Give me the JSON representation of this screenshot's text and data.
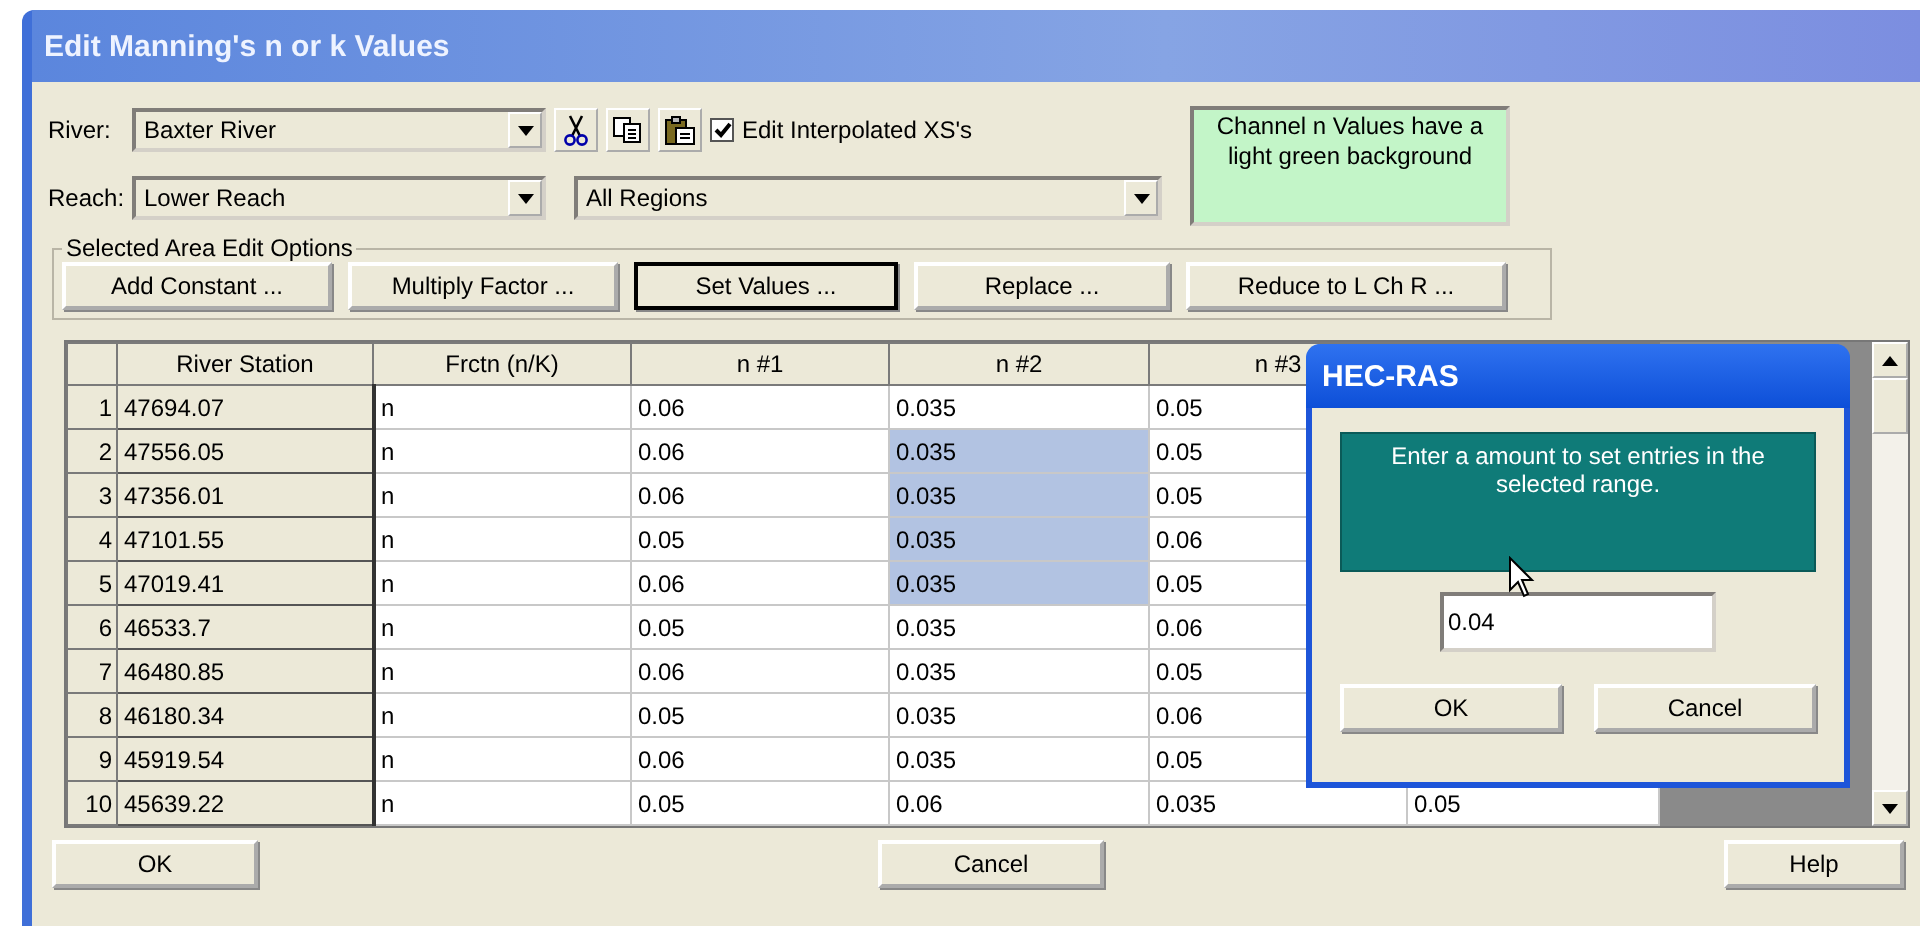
{
  "window": {
    "title": "Edit Manning's n or k Values"
  },
  "river": {
    "label": "River:",
    "value": "Baxter River"
  },
  "reach": {
    "label": "Reach:",
    "value": "Lower Reach"
  },
  "regions": {
    "value": "All Regions"
  },
  "edit_interpolated": {
    "label": "Edit Interpolated XS's",
    "checked": true
  },
  "note": "Channel n Values have a light green background",
  "edit_options": {
    "title": "Selected Area Edit Options",
    "buttons": [
      {
        "label": "Add Constant ...",
        "focused": false
      },
      {
        "label": "Multiply Factor ...",
        "focused": false
      },
      {
        "label": "Set Values ...",
        "focused": true
      },
      {
        "label": "Replace ...",
        "focused": false
      },
      {
        "label": "Reduce to L Ch R ...",
        "focused": false
      }
    ]
  },
  "table": {
    "columns": [
      "River Station",
      "Frctn (n/K)",
      "n #1",
      "n #2",
      "n #3"
    ],
    "rows": [
      {
        "number": "1",
        "station": "47694.07",
        "frctn": "n",
        "values": [
          "0.06",
          "0.035",
          "0.05"
        ],
        "selected": [
          false,
          false,
          false
        ]
      },
      {
        "number": "2",
        "station": "47556.05",
        "frctn": "n",
        "values": [
          "0.06",
          "0.035",
          "0.05"
        ],
        "selected": [
          false,
          true,
          false
        ]
      },
      {
        "number": "3",
        "station": "47356.01",
        "frctn": "n",
        "values": [
          "0.06",
          "0.035",
          "0.05"
        ],
        "selected": [
          false,
          true,
          false
        ]
      },
      {
        "number": "4",
        "station": "47101.55",
        "frctn": "n",
        "values": [
          "0.05",
          "0.035",
          "0.06"
        ],
        "selected": [
          false,
          true,
          false
        ]
      },
      {
        "number": "5",
        "station": "47019.41",
        "frctn": "n",
        "values": [
          "0.06",
          "0.035",
          "0.05"
        ],
        "selected": [
          false,
          true,
          false
        ]
      },
      {
        "number": "6",
        "station": "46533.7",
        "frctn": "n",
        "values": [
          "0.05",
          "0.035",
          "0.06"
        ],
        "selected": [
          false,
          false,
          false
        ]
      },
      {
        "number": "7",
        "station": "46480.85",
        "frctn": "n",
        "values": [
          "0.06",
          "0.035",
          "0.05"
        ],
        "selected": [
          false,
          false,
          false
        ]
      },
      {
        "number": "8",
        "station": "46180.34",
        "frctn": "n",
        "values": [
          "0.05",
          "0.035",
          "0.06"
        ],
        "selected": [
          false,
          false,
          false
        ]
      },
      {
        "number": "9",
        "station": "45919.54",
        "frctn": "n",
        "values": [
          "0.06",
          "0.035",
          "0.05"
        ],
        "selected": [
          false,
          false,
          false
        ]
      },
      {
        "number": "10",
        "station": "45639.22",
        "frctn": "n",
        "values": [
          "0.05",
          "0.06",
          "0.035",
          "0.05"
        ],
        "selected": [
          false,
          false,
          false,
          false
        ]
      }
    ]
  },
  "buttons": [
    "OK",
    "Cancel",
    "Help"
  ],
  "dialog": {
    "title": "HEC-RAS",
    "message": "Enter a amount to set entries in the selected range.",
    "value": "0.04",
    "buttons": [
      "OK",
      "Cancel"
    ]
  }
}
